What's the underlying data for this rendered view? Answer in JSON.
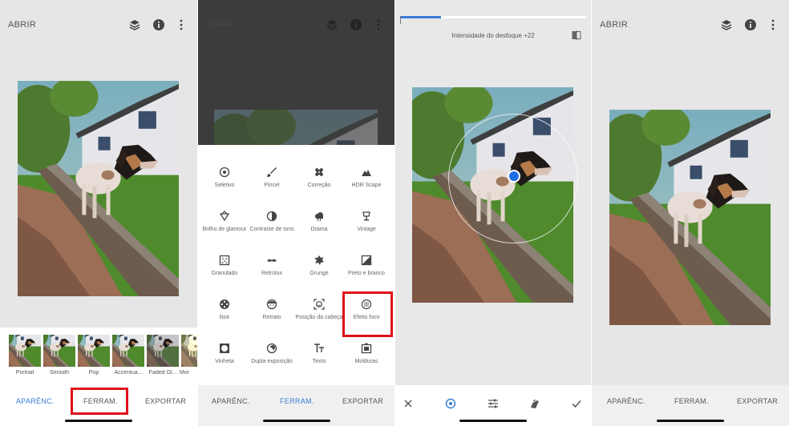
{
  "panel1": {
    "header": {
      "title": "ABRIR",
      "icons": [
        "layers-icon",
        "info-icon",
        "more-vert-icon"
      ]
    },
    "filters": [
      {
        "label": "Portrait"
      },
      {
        "label": "Smooth"
      },
      {
        "label": "Pop"
      },
      {
        "label": "Accentua..."
      },
      {
        "label": "Faded Gl..."
      },
      {
        "label": "Mor"
      }
    ],
    "tabs": {
      "looks": "APARÊNC.",
      "tools": "FERRAM.",
      "export": "EXPORTAR"
    },
    "active_tab": "tools",
    "highlight": "tools-tab"
  },
  "panel2": {
    "header": {
      "title": "ABRIR"
    },
    "tools": [
      {
        "label": "Seletivo",
        "icon": "target-icon"
      },
      {
        "label": "Pincel",
        "icon": "brush-icon"
      },
      {
        "label": "Correção",
        "icon": "bandage-icon"
      },
      {
        "label": "HDR Scape",
        "icon": "mountain-icon"
      },
      {
        "label": "Brilho de glamour",
        "icon": "diamond-icon"
      },
      {
        "label": "Contraste de tons",
        "icon": "tonal-contrast-icon"
      },
      {
        "label": "Drama",
        "icon": "cloud-icon"
      },
      {
        "label": "Vintage",
        "icon": "lamp-icon"
      },
      {
        "label": "Granulado",
        "icon": "grain-icon"
      },
      {
        "label": "Retrolux",
        "icon": "mustache-icon"
      },
      {
        "label": "Grunge",
        "icon": "grunge-icon"
      },
      {
        "label": "Preto e branco",
        "icon": "bw-photo-icon"
      },
      {
        "label": "Noir",
        "icon": "film-reel-icon"
      },
      {
        "label": "Retrato",
        "icon": "face-icon"
      },
      {
        "label": "Posição da cabeça",
        "icon": "head-pose-icon"
      },
      {
        "label": "Efeito foco",
        "icon": "lens-blur-icon"
      },
      {
        "label": "Vinheta",
        "icon": "vignette-icon"
      },
      {
        "label": "Dupla exposição",
        "icon": "double-exposure-icon"
      },
      {
        "label": "Texto",
        "icon": "text-icon"
      },
      {
        "label": "Molduras",
        "icon": "frame-icon"
      }
    ],
    "highlight": "Efeito foco",
    "tabs": {
      "looks": "APARÊNC.",
      "tools": "FERRAM.",
      "export": "EXPORTAR"
    },
    "active_tab": "tools"
  },
  "panel3": {
    "status": "Intensidade do desfoque +22",
    "progress": 0.22,
    "controls": [
      "close-icon",
      "focus-target-icon",
      "sliders-icon",
      "styles-icon",
      "check-icon"
    ],
    "accent": "#1e6ee6"
  },
  "panel4": {
    "header": {
      "title": "ABRIR"
    },
    "tabs": {
      "looks": "APARÊNC.",
      "tools": "FERRAM.",
      "export": "EXPORTAR"
    }
  },
  "colors": {
    "accent": "#3a7bd5",
    "highlight_box": "#e0101a"
  }
}
